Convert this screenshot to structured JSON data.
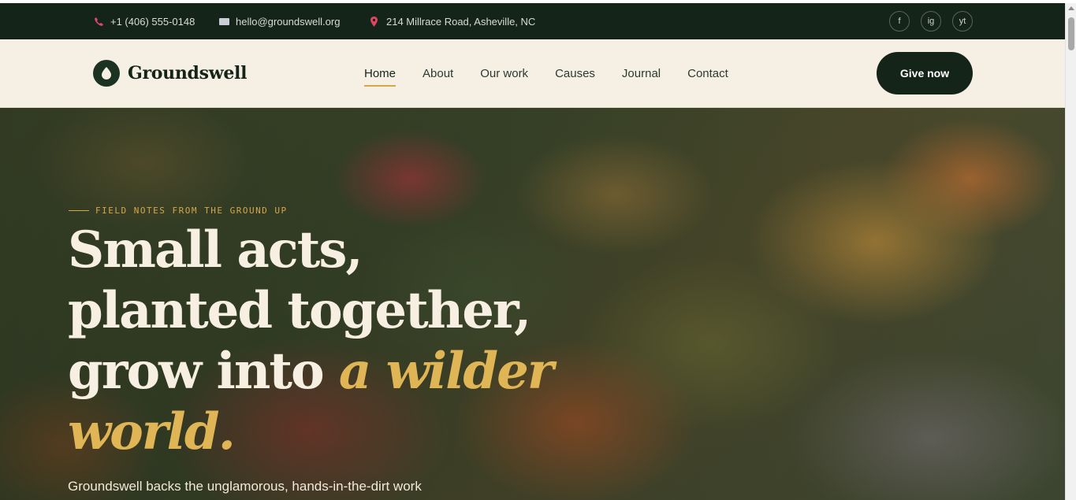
{
  "topbar": {
    "phone": "+1 (406) 555-0148",
    "email": "hello@groundswell.org",
    "address": "214 Millrace Road, Asheville, NC",
    "socials": [
      "f",
      "ig",
      "yt"
    ]
  },
  "brand": {
    "name": "Groundswell"
  },
  "nav": {
    "items": [
      {
        "label": "Home",
        "active": true
      },
      {
        "label": "About"
      },
      {
        "label": "Our work"
      },
      {
        "label": "Causes"
      },
      {
        "label": "Journal"
      },
      {
        "label": "Contact"
      }
    ],
    "cta": "Give now"
  },
  "hero": {
    "eyebrow": "FIELD NOTES FROM THE GROUND UP",
    "headline_line1": "Small acts,",
    "headline_line2": "planted together,",
    "headline_line3_plain": "grow into ",
    "headline_line3_accent": "a wilder",
    "headline_line4_accent": "world.",
    "lede": "Groundswell backs the unglamorous, hands-in-the-dirt work"
  },
  "colors": {
    "topbar_bg": "#142419",
    "nav_bg": "#f6efe4",
    "accent_gold": "#d5a64a",
    "cta_bg": "#142419"
  }
}
